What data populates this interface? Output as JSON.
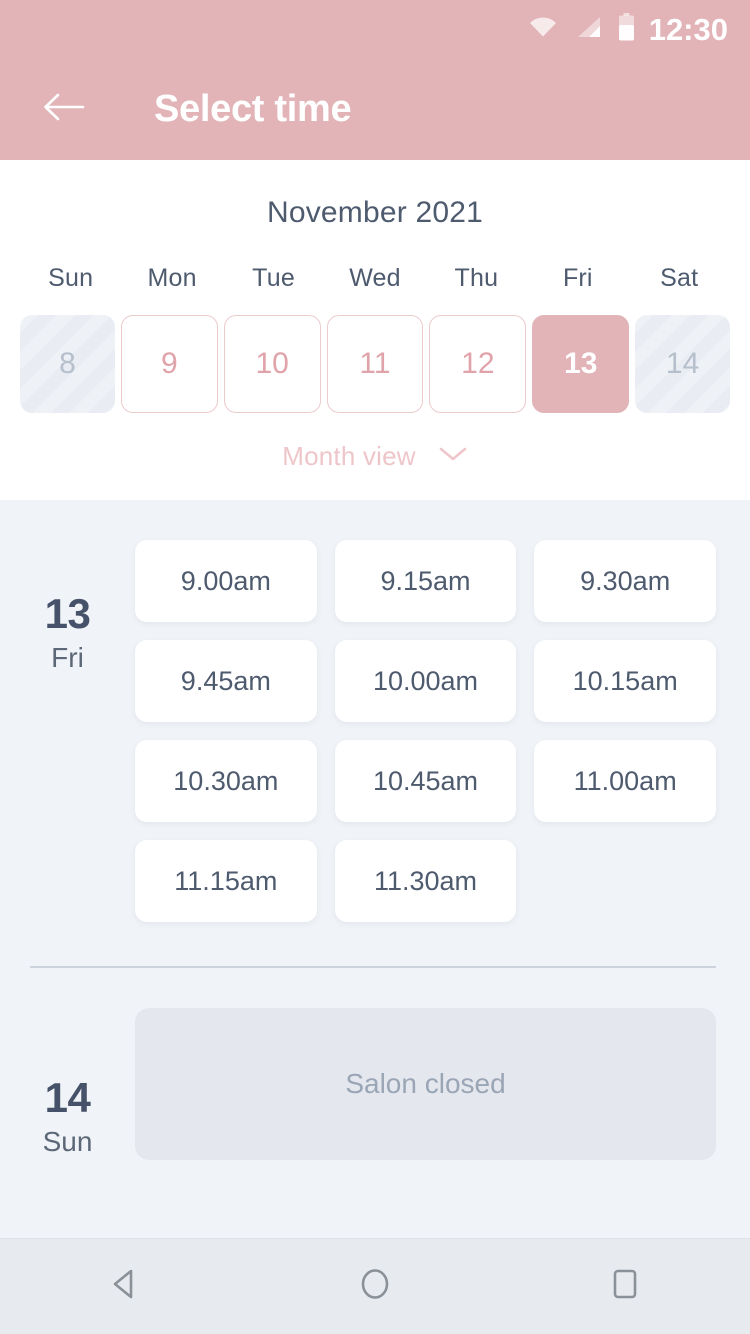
{
  "status_bar": {
    "time": "12:30",
    "icons": [
      "wifi-icon",
      "cellular-signal-icon",
      "battery-icon"
    ]
  },
  "app_bar": {
    "back_icon": "back-arrow-icon",
    "title": "Select time"
  },
  "calendar": {
    "month_title": "November 2021",
    "weekdays": [
      "Sun",
      "Mon",
      "Tue",
      "Wed",
      "Thu",
      "Fri",
      "Sat"
    ],
    "days": [
      {
        "label": "8",
        "state": "disabled"
      },
      {
        "label": "9",
        "state": "available"
      },
      {
        "label": "10",
        "state": "available"
      },
      {
        "label": "11",
        "state": "available"
      },
      {
        "label": "12",
        "state": "available"
      },
      {
        "label": "13",
        "state": "selected"
      },
      {
        "label": "14",
        "state": "disabled"
      }
    ],
    "month_view_label": "Month view",
    "month_view_icon": "chevron-down-icon"
  },
  "slots_section": {
    "groups": [
      {
        "day_number": "13",
        "day_of_week": "Fri",
        "slots": [
          "9.00am",
          "9.15am",
          "9.30am",
          "9.45am",
          "10.00am",
          "10.15am",
          "10.30am",
          "10.45am",
          "11.00am",
          "11.15am",
          "11.30am"
        ]
      },
      {
        "day_number": "14",
        "day_of_week": "Sun",
        "closed_label": "Salon closed"
      }
    ]
  },
  "nav_bar": {
    "back_icon": "android-back-icon",
    "home_icon": "android-home-icon",
    "recents_icon": "android-recents-icon"
  },
  "colors": {
    "brand_pink": "#e2b4b8",
    "pink_border": "#eccacd",
    "pink_text": "#e0a3a9",
    "slate": "#4e5a6e",
    "panel_bg": "#f0f3f7",
    "closed_bg": "#e4e8ee"
  }
}
